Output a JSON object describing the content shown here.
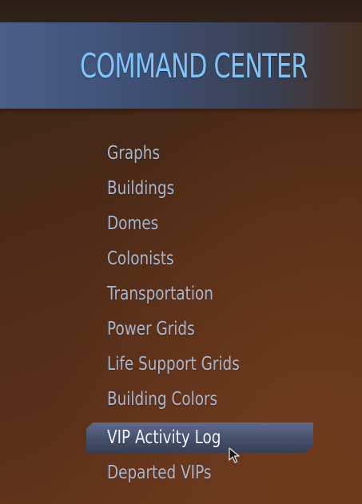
{
  "header": {
    "title": "COMMAND CENTER"
  },
  "menu": {
    "items": [
      {
        "label": "Graphs"
      },
      {
        "label": "Buildings"
      },
      {
        "label": "Domes"
      },
      {
        "label": "Colonists"
      },
      {
        "label": "Transportation"
      },
      {
        "label": "Power Grids"
      },
      {
        "label": "Life Support Grids"
      },
      {
        "label": "Building Colors"
      },
      {
        "label": "VIP Activity Log"
      },
      {
        "label": "Departed VIPs"
      }
    ],
    "selected_item": "VIP Activity Log"
  },
  "colors": {
    "title": "#7ec4f8",
    "item_text": "#a9b6cf",
    "selected_text": "#f2f4fa",
    "selected_bg": "#46526e",
    "header_band": "#3d4f72",
    "background": "#5a301a"
  },
  "icons": {
    "cursor": "mouse-pointer-icon"
  }
}
